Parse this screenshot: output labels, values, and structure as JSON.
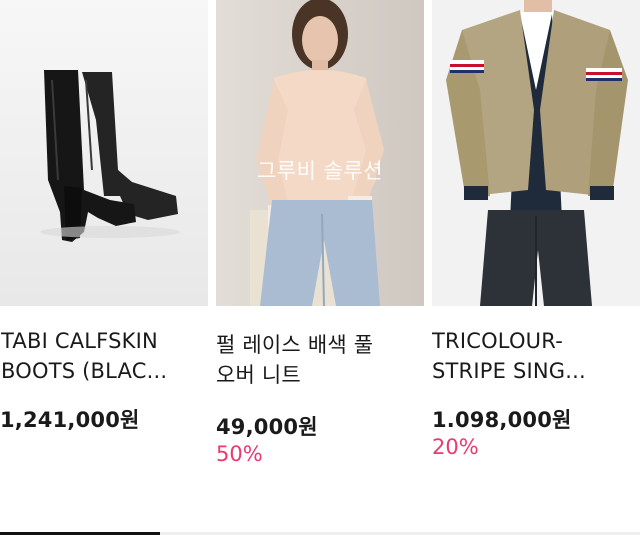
{
  "products": [
    {
      "name_line1": "TABI CALFSKIN",
      "name_line2": "BOOTS (BLAC...",
      "price": "1,241,000원",
      "discount": "",
      "image": "black-tabi-boots-photo"
    },
    {
      "name_line1": "펄 레이스 배색 풀",
      "name_line2": "오버 니트",
      "price": "49,000원",
      "discount": "50%",
      "overlay": "그루비 솔루션",
      "image": "model-in-pink-knit-sweater-photo"
    },
    {
      "name_line1": "TRICOLOUR-",
      "name_line2": "STRIPE SING...",
      "price": "1.098,000원",
      "discount": "20%",
      "image": "man-in-khaki-blazer-photo"
    }
  ],
  "colors": {
    "discount": "#ea3a6f",
    "text": "#1a1a1a",
    "tab_active": "#111111",
    "tab_track": "#eeeeee"
  }
}
